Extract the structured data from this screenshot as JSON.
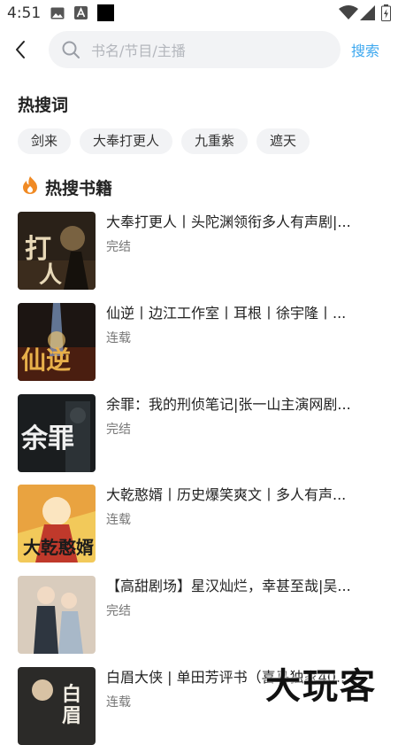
{
  "status_bar": {
    "time": "4:51",
    "icons": [
      "image-icon",
      "a-icon",
      "black-square-icon",
      "wifi-icon",
      "signal-icon",
      "battery-icon"
    ]
  },
  "search": {
    "placeholder": "书名/节目/主播",
    "button_label": "搜索"
  },
  "hot_words": {
    "title": "热搜词",
    "tags": [
      "剑来",
      "大奉打更人",
      "九重紫",
      "遮天"
    ]
  },
  "hot_books": {
    "title": "热搜书籍",
    "items": [
      {
        "title": "大奉打更人丨头陀渊领衔多人有声剧|...",
        "status": "完结"
      },
      {
        "title": "仙逆丨边江工作室丨耳根丨徐宇隆丨...",
        "status": "连载"
      },
      {
        "title": "余罪：我的刑侦笔记|张一山主演网剧...",
        "status": "完结"
      },
      {
        "title": "大乾憨婿丨历史爆笑爽文丨多人有声...",
        "status": "连载"
      },
      {
        "title": "【高甜剧场】星汉灿烂，幸甚至哉|吴...",
        "status": "完结"
      },
      {
        "title": "白眉大侠 | 单田芳评书（喜马独家40...",
        "status": "连载"
      }
    ]
  },
  "watermark": "大玩客",
  "colors": {
    "accent": "#3ea8ef",
    "fire": "#f08a24"
  }
}
